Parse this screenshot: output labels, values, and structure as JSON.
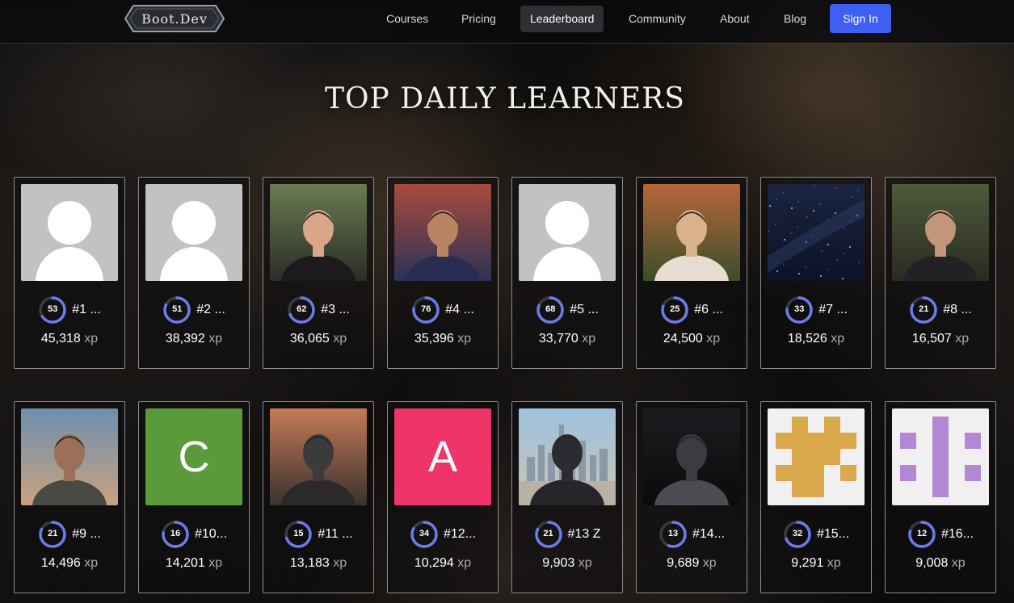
{
  "nav": {
    "logo_text": "Boot.Dev",
    "links": [
      "Courses",
      "Pricing",
      "Leaderboard",
      "Community",
      "About",
      "Blog"
    ],
    "active": "Leaderboard",
    "sign_in": "Sign In"
  },
  "page_title": "TOP DAILY LEARNERS",
  "colors": {
    "accent": "#3f5ef2",
    "ring": "#6c7bea",
    "ring_track": "#3a3a44"
  },
  "xp_unit": "xp",
  "learners": [
    {
      "rank_label": "#1 ...",
      "level": "53",
      "xp": "45,318",
      "avatar": "default-avatar"
    },
    {
      "rank_label": "#2 ...",
      "level": "51",
      "xp": "38,392",
      "avatar": "default-avatar"
    },
    {
      "rank_label": "#3 ...",
      "level": "62",
      "xp": "36,065",
      "avatar": "photo"
    },
    {
      "rank_label": "#4 ...",
      "level": "76",
      "xp": "35,396",
      "avatar": "photo"
    },
    {
      "rank_label": "#5 ...",
      "level": "68",
      "xp": "33,770",
      "avatar": "default-avatar"
    },
    {
      "rank_label": "#6 ...",
      "level": "25",
      "xp": "24,500",
      "avatar": "photo"
    },
    {
      "rank_label": "#7 ...",
      "level": "33",
      "xp": "18,526",
      "avatar": "photo"
    },
    {
      "rank_label": "#8 ...",
      "level": "21",
      "xp": "16,507",
      "avatar": "photo"
    },
    {
      "rank_label": "#9 ...",
      "level": "21",
      "xp": "14,496",
      "avatar": "photo"
    },
    {
      "rank_label": "#10...",
      "level": "16",
      "xp": "14,201",
      "avatar": "letter",
      "letter": "C",
      "color": "#5a9a3a"
    },
    {
      "rank_label": "#11 ...",
      "level": "15",
      "xp": "13,183",
      "avatar": "photo"
    },
    {
      "rank_label": "#12...",
      "level": "34",
      "xp": "10,294",
      "avatar": "letter",
      "letter": "A",
      "color": "#ee3468"
    },
    {
      "rank_label": "#13 Z",
      "level": "21",
      "xp": "9,903",
      "avatar": "photo"
    },
    {
      "rank_label": "#14...",
      "level": "13",
      "xp": "9,689",
      "avatar": "photo"
    },
    {
      "rank_label": "#15...",
      "level": "32",
      "xp": "9,291",
      "avatar": "identicon"
    },
    {
      "rank_label": "#16...",
      "level": "12",
      "xp": "9,008",
      "avatar": "identicon"
    }
  ]
}
